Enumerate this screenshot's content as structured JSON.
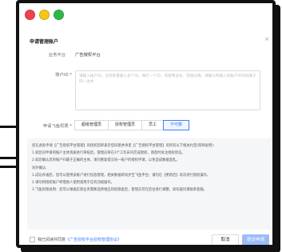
{
  "dialog": {
    "title": "申请管理账户",
    "close": "×"
  },
  "form": {
    "platform_label": "业务平台",
    "platform_value": "广告授权平台",
    "account_label": "账户ID *",
    "account_placeholder": "请输入账户ID，支持批量输入多个ID，每行一个ID，或使用逗号、空格分隔，请确认所输入的账户ID均归属于同一主体",
    "role_label": "申请飞鱼权限 *",
    "roles": [
      "超级管理员",
      "授权管理员",
      "员工",
      "不可删"
    ],
    "selected_role": "不可删"
  },
  "notice": {
    "lines": [
      "您在此处申请【广告授权平台管理】的授权后即表示您同意并承诺【广告授权平台管理】的所有以下相关约定(简称说明)：",
      "1.如您对申请的账户主体资质进行审核后，管理员将在3个工作日内完成授权，请及时关注授权状态。",
      "2.如您确认您的账户归属于正确的主体，请勿重复提交同一账户的授权申请，以免造成数据混乱。",
      "对外确认:",
      "1.成功开通后，您可以使用该账户进行投放管理，相关数据将同步至飞鱼平台；请勿在【更新后】再次进行授权操作。",
      "2.请勿将授权账户转借他人使用或用于任何违规操作。",
      "3.飞鱼权限说明：您可以根据实际业务需要选择相应的权限类型，管理员可在后台进行调整，如有疑问请联系客服。"
    ]
  },
  "footer": {
    "agree_text": "我已阅读并同意",
    "agree_link": "《广告授权平台授权管理协议》",
    "cancel": "取消",
    "submit": "提交申请"
  },
  "window": {
    "traffic_lights": [
      "red-dot",
      "yellow-dot",
      "green-dot"
    ],
    "colors": {
      "red": "#ef4350",
      "yellow": "#f5c518",
      "green": "#2eb84b",
      "accent": "#3d7eff"
    }
  }
}
